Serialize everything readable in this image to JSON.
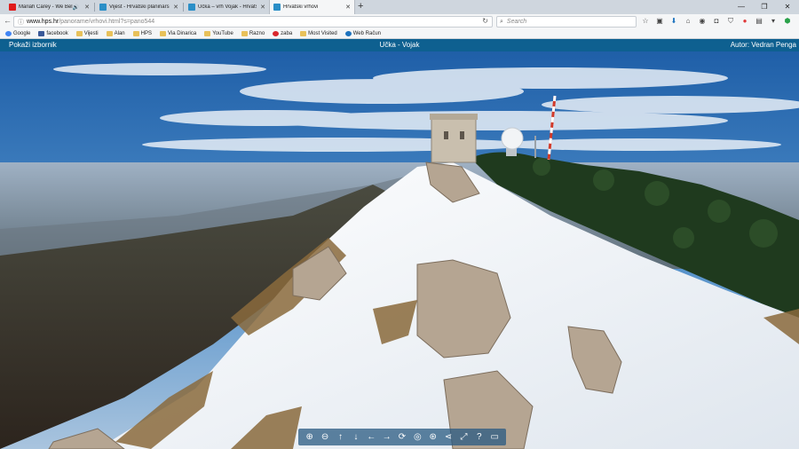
{
  "browser": {
    "tabs": [
      {
        "title": "Mariah Carey - We Bel...",
        "icon_color": "#e01b1b",
        "has_sound": true
      },
      {
        "title": "Vijest - Hrvatski planinarsk...",
        "icon_color": "#2b8fc7",
        "has_sound": false
      },
      {
        "title": "Učka – vrh Vojak - Hrvatsk...",
        "icon_color": "#2b8fc7",
        "has_sound": false
      },
      {
        "title": "Hrvatski vrhovi",
        "icon_color": "#2b8fc7",
        "has_sound": false,
        "active": true
      }
    ],
    "url_domain": "www.hps.hr",
    "url_path": "/panorame/vrhovi.html?s=pano544",
    "search_placeholder": "Search",
    "bookmarks": [
      {
        "label": "Google",
        "icon": "google-icon",
        "color": "#4285f4"
      },
      {
        "label": "facebook",
        "icon": "facebook-icon",
        "color": "#3b5998"
      },
      {
        "label": "Vijesti",
        "icon": "folder-icon",
        "color": "#e8c15a"
      },
      {
        "label": "Alan",
        "icon": "folder-icon",
        "color": "#e8c15a"
      },
      {
        "label": "HPS",
        "icon": "folder-icon",
        "color": "#e8c15a"
      },
      {
        "label": "Via Dinarica",
        "icon": "folder-icon",
        "color": "#e8c15a"
      },
      {
        "label": "YouTube",
        "icon": "folder-icon",
        "color": "#e8c15a"
      },
      {
        "label": "Razno",
        "icon": "folder-icon",
        "color": "#e8c15a"
      },
      {
        "label": "zaba",
        "icon": "zaba-icon",
        "color": "#d8262c"
      },
      {
        "label": "Most Visited",
        "icon": "folder-icon",
        "color": "#e8c15a"
      },
      {
        "label": "Web Račun",
        "icon": "web-racun-icon",
        "color": "#1e73be"
      }
    ]
  },
  "page": {
    "menu_label": "Pokaži izbornik",
    "title": "Učka - Vojak",
    "author": "Autor: Vedran Penga",
    "header_color": "#0e6090"
  },
  "controls": [
    "zoom-in-icon",
    "zoom-out-icon",
    "arrow-up-icon",
    "arrow-down-icon",
    "arrow-left-icon",
    "arrow-right-icon",
    "autorotate-icon",
    "gyro-icon",
    "globe-icon",
    "share-icon",
    "fullscreen-icon",
    "help-icon",
    "screen-icon"
  ]
}
